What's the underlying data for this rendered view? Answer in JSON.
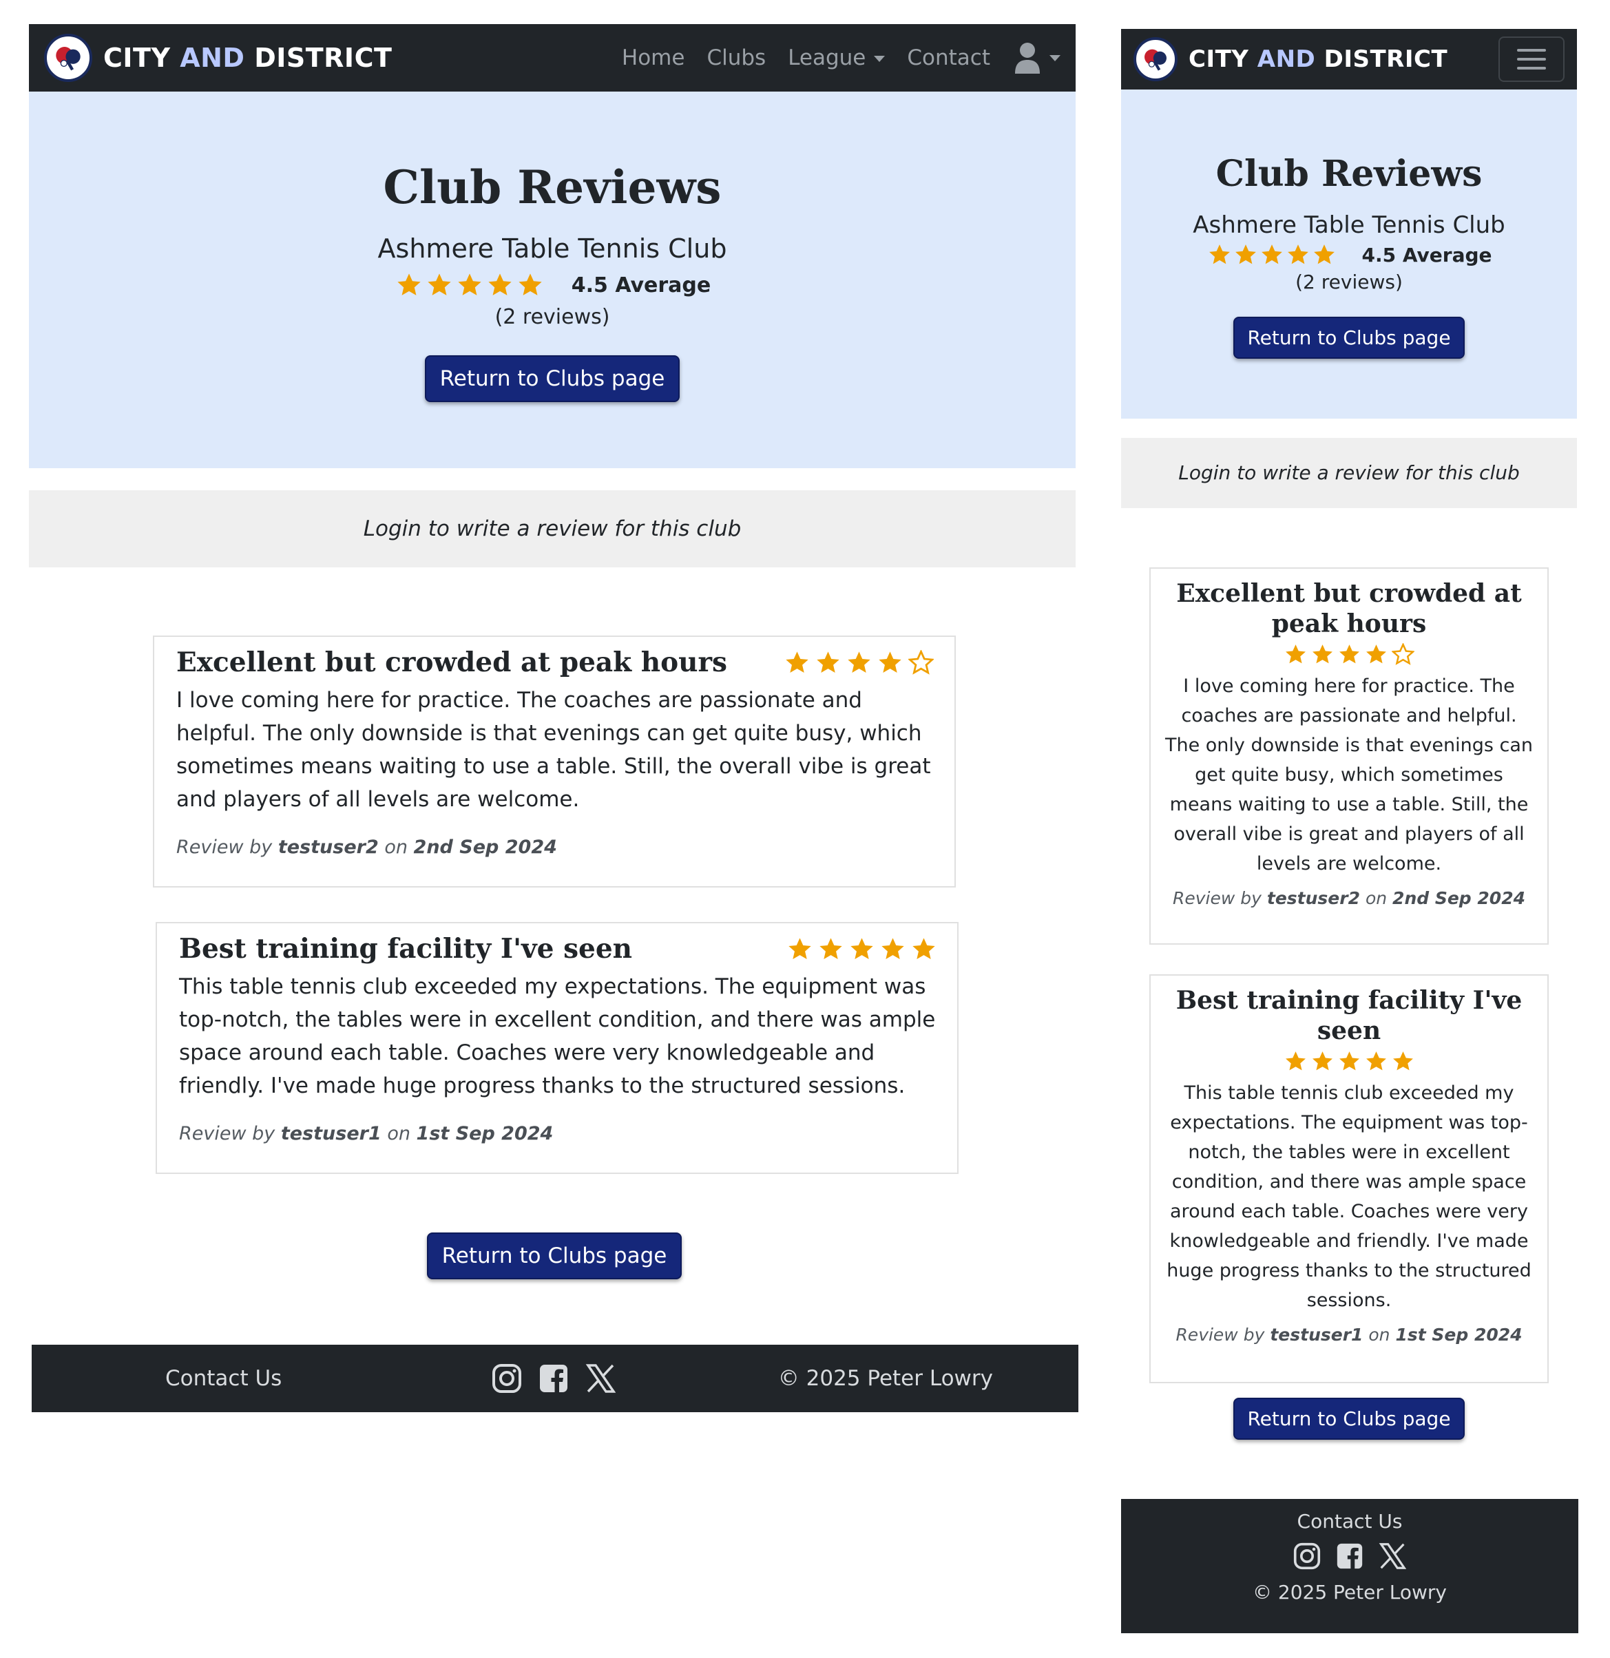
{
  "brand": {
    "part1": "CITY ",
    "accent": "AND",
    "part2": " DISTRICT"
  },
  "nav": {
    "home": "Home",
    "clubs": "Clubs",
    "league": "League",
    "contact": "Contact"
  },
  "hero": {
    "title": "Club Reviews",
    "club_name": "Ashmere Table Tennis Club",
    "average_rating": 4.5,
    "average_label": "4.5 Average",
    "review_count": "(2 reviews)",
    "return_button": "Return to Clubs page"
  },
  "login_prompt": "Login to write a review for this club",
  "reviews": [
    {
      "title": "Excellent but crowded at peak hours",
      "rating": 4,
      "body": "I love coming here for practice. The coaches are passionate and helpful. The only downside is that evenings can get quite busy, which sometimes means waiting to use a table. Still, the overall vibe is great and players of all levels are welcome.",
      "by_label": "Review by ",
      "user": "testuser2",
      "on_label": " on ",
      "date": "2nd Sep 2024"
    },
    {
      "title": "Best training facility I've seen",
      "rating": 5,
      "body": "This table tennis club exceeded my expectations. The equipment was top-notch, the tables were in excellent condition, and there was ample space around each table. Coaches were very knowledgeable and friendly. I've made huge progress thanks to the structured sessions.",
      "by_label": "Review by ",
      "user": "testuser1",
      "on_label": " on ",
      "date": "1st Sep 2024"
    }
  ],
  "bottom_button": "Return to Clubs page",
  "footer": {
    "contact": "Contact Us",
    "copyright": "© 2025 Peter Lowry",
    "social_icons": [
      "instagram-icon",
      "facebook-icon",
      "x-icon"
    ]
  },
  "colors": {
    "navbar": "#212529",
    "hero_bg": "#dde9fb",
    "button": "#15277a",
    "star": "#f0a000",
    "login_bg": "#efefef"
  }
}
